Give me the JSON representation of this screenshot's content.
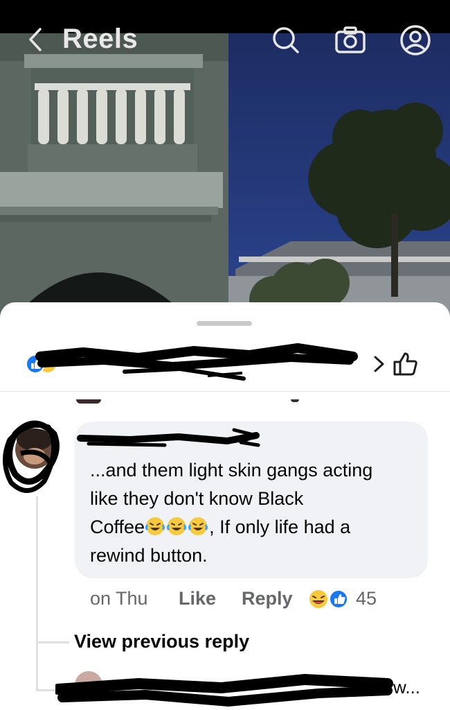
{
  "header": {
    "title": "Reels",
    "icons": [
      "back-chevron-icon",
      "search-icon",
      "camera-icon",
      "profile-icon"
    ]
  },
  "reactions_bar": {
    "icons": [
      "like-reaction-icon",
      "haha-reaction-icon"
    ],
    "redacted": true,
    "nav_icon": "chevron-right-icon",
    "like_button_icon": "thumbs-up-icon"
  },
  "comment": {
    "author_redacted": true,
    "text_line1": "...and them light skin gangs acting",
    "text_line2": "like they don't know Black",
    "text_line3_a": "Coffee",
    "text_line3_b": ", If only life had a",
    "text_line4": "rewind button.",
    "emojis": [
      "rolling-laughing-emoji",
      "rolling-laughing-emoji",
      "rolling-laughing-emoji"
    ],
    "timestamp": "on Thu",
    "like_label": "Like",
    "reply_label": "Reply",
    "reaction_icons": [
      "haha-reaction-icon",
      "like-reaction-icon"
    ],
    "reaction_count": "45"
  },
  "replies": {
    "view_previous_label": "View previous reply",
    "next_reply_tail": "w..."
  },
  "colors": {
    "like_blue": "#1877f2",
    "haha_yellow": "#f7c93e",
    "bubble_bg": "#f0f2f5",
    "secondary_text": "#65676b"
  }
}
